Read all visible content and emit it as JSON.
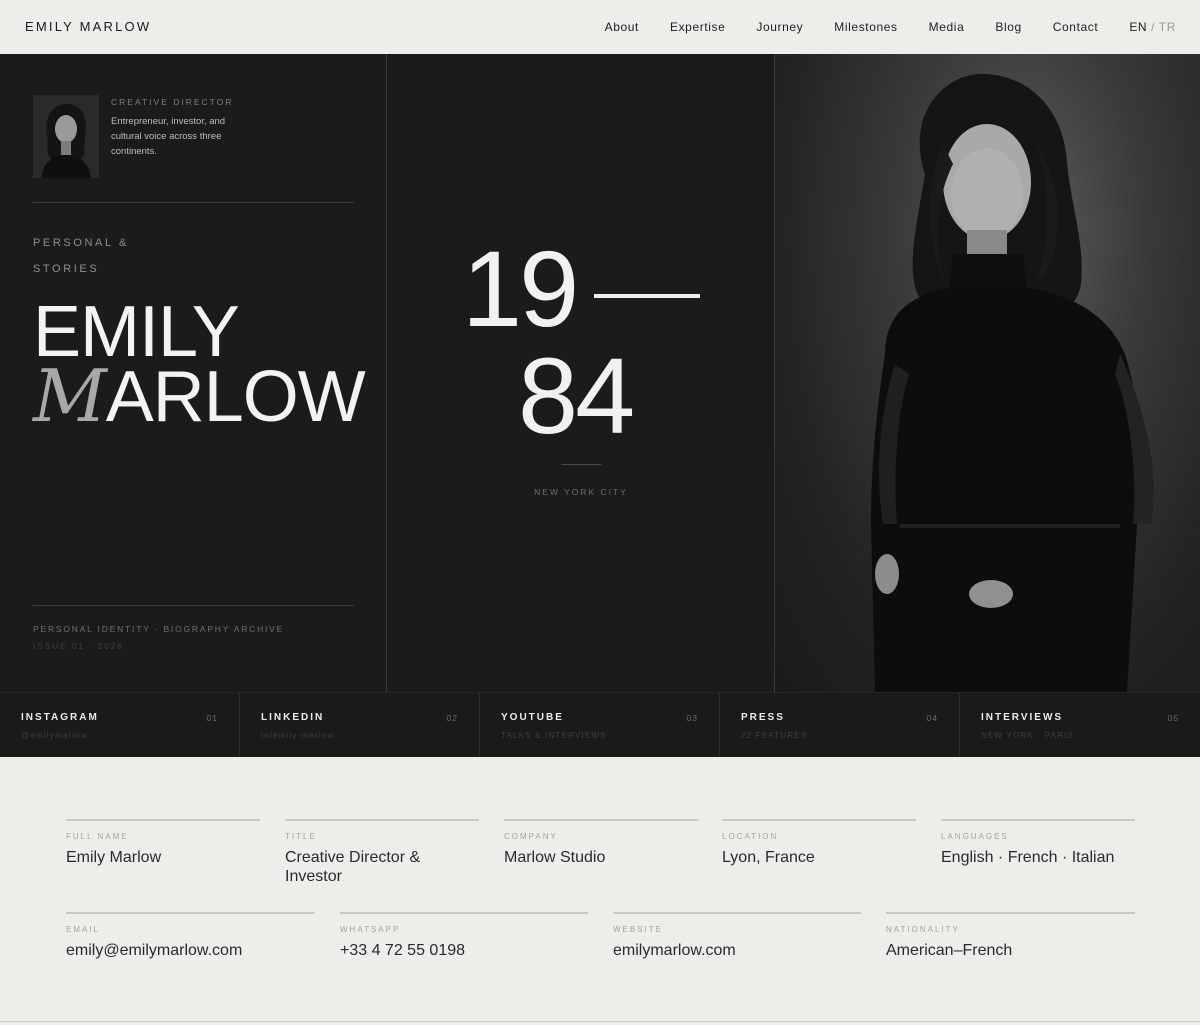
{
  "brand": "EMILY MARLOW",
  "nav": {
    "items": [
      "About",
      "Expertise",
      "Journey",
      "Milestones",
      "Media",
      "Blog",
      "Contact"
    ],
    "lang_active": "EN",
    "lang_sep": "/",
    "lang_other": "TR"
  },
  "hero": {
    "role": "CREATIVE DIRECTOR",
    "description": "Entrepreneur, investor, and cultural voice across three continents.",
    "kicker_line1": "PERSONAL &",
    "kicker_line2": "STORIES",
    "name_first": "EMILY",
    "name_last_initial": "M",
    "name_last_rest": "ARLOW",
    "archive": "PERSONAL IDENTITY · BIOGRAPHY ARCHIVE",
    "issue": "ISSUE 01 · 2026",
    "year_top": "19",
    "year_bottom": "84",
    "city": "NEW YORK CITY"
  },
  "social": [
    {
      "name": "INSTAGRAM",
      "num": "01",
      "sub": "@emilymarlow"
    },
    {
      "name": "LINKEDIN",
      "num": "02",
      "sub": "in/emily-marlow"
    },
    {
      "name": "YOUTUBE",
      "num": "03",
      "sub": "TALKS & INTERVIEWS"
    },
    {
      "name": "PRESS",
      "num": "04",
      "sub": "22 FEATURES"
    },
    {
      "name": "INTERVIEWS",
      "num": "05",
      "sub": "NEW YORK · PARIS"
    }
  ],
  "info": {
    "full_name": {
      "label": "FULL NAME",
      "value": "Emily Marlow"
    },
    "title": {
      "label": "TITLE",
      "value": "Creative Director & Investor"
    },
    "company": {
      "label": "COMPANY",
      "value": "Marlow Studio"
    },
    "location": {
      "label": "LOCATION",
      "value": "Lyon, France"
    },
    "languages": {
      "label": "LANGUAGES",
      "value": "English · French · Italian"
    },
    "email": {
      "label": "EMAIL",
      "value": "emily@emilymarlow.com"
    },
    "whatsapp": {
      "label": "WHATSAPP",
      "value": "+33 4 72 55 0198"
    },
    "website": {
      "label": "WEBSITE",
      "value": "emilymarlow.com"
    },
    "nationality": {
      "label": "NATIONALITY",
      "value": "American–French"
    }
  }
}
